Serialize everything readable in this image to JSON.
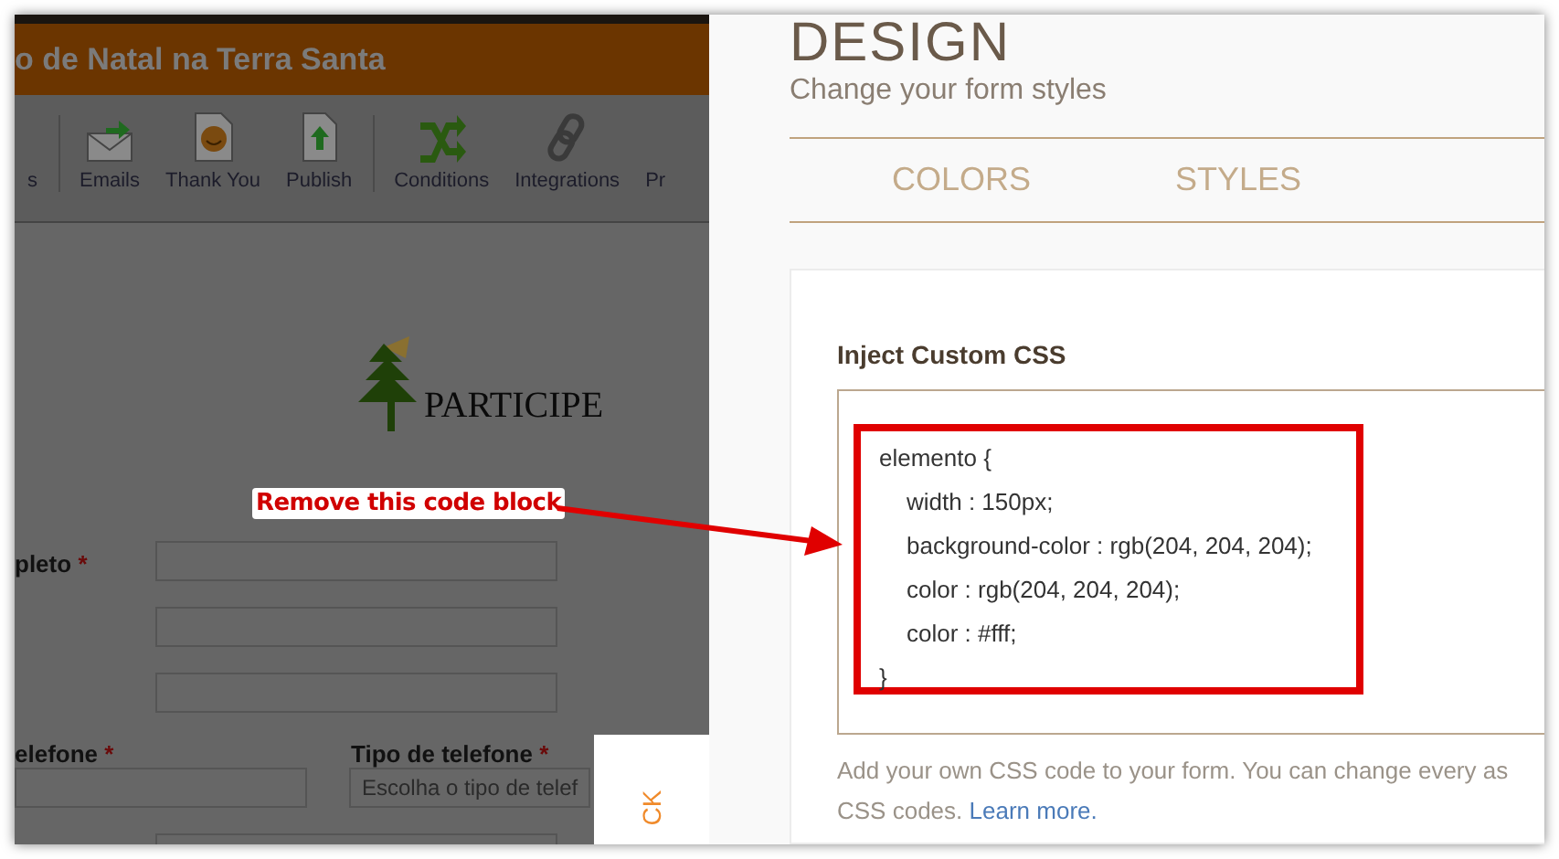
{
  "builder": {
    "form_title": "o de Natal na Terra Santa",
    "toolbar": [
      {
        "label": "s"
      },
      {
        "label": "Emails"
      },
      {
        "label": "Thank You"
      },
      {
        "label": "Publish"
      },
      {
        "label": "Conditions"
      },
      {
        "label": "Integrations"
      },
      {
        "label": "Pr"
      }
    ],
    "logo_text": "PARTICIPE",
    "name_label": "pleto",
    "required_mark": "*",
    "phone_label": "elefone",
    "phone_type_label": "Tipo de telefone",
    "phone_required_mark": "*",
    "phone_type_required_mark": "*",
    "phone_type_placeholder": "Escolha o tipo de telef",
    "side_tab": "CK"
  },
  "annotation": {
    "text": "Remove this code block"
  },
  "design": {
    "title": "DESIGN",
    "subtitle": "Change your form styles",
    "tabs": [
      {
        "label": "COLORS",
        "selected": false
      },
      {
        "label": "STYLES",
        "selected": false
      }
    ],
    "css_label": "Inject Custom CSS",
    "code_lines": [
      {
        "kind": "selector",
        "text": "elemento {"
      },
      {
        "kind": "declaration",
        "text": "width : 150px;"
      },
      {
        "kind": "declaration",
        "text": "background-color : rgb(204, 204, 204);"
      },
      {
        "kind": "declaration",
        "text": "color : rgb(204, 204, 204);"
      },
      {
        "kind": "declaration",
        "text": "color : #fff;"
      },
      {
        "kind": "close",
        "text": "}"
      }
    ],
    "help_text": "Add your own CSS code to your form. You can change every as",
    "help_text_2": "CSS codes.",
    "help_link": "Learn more."
  }
}
